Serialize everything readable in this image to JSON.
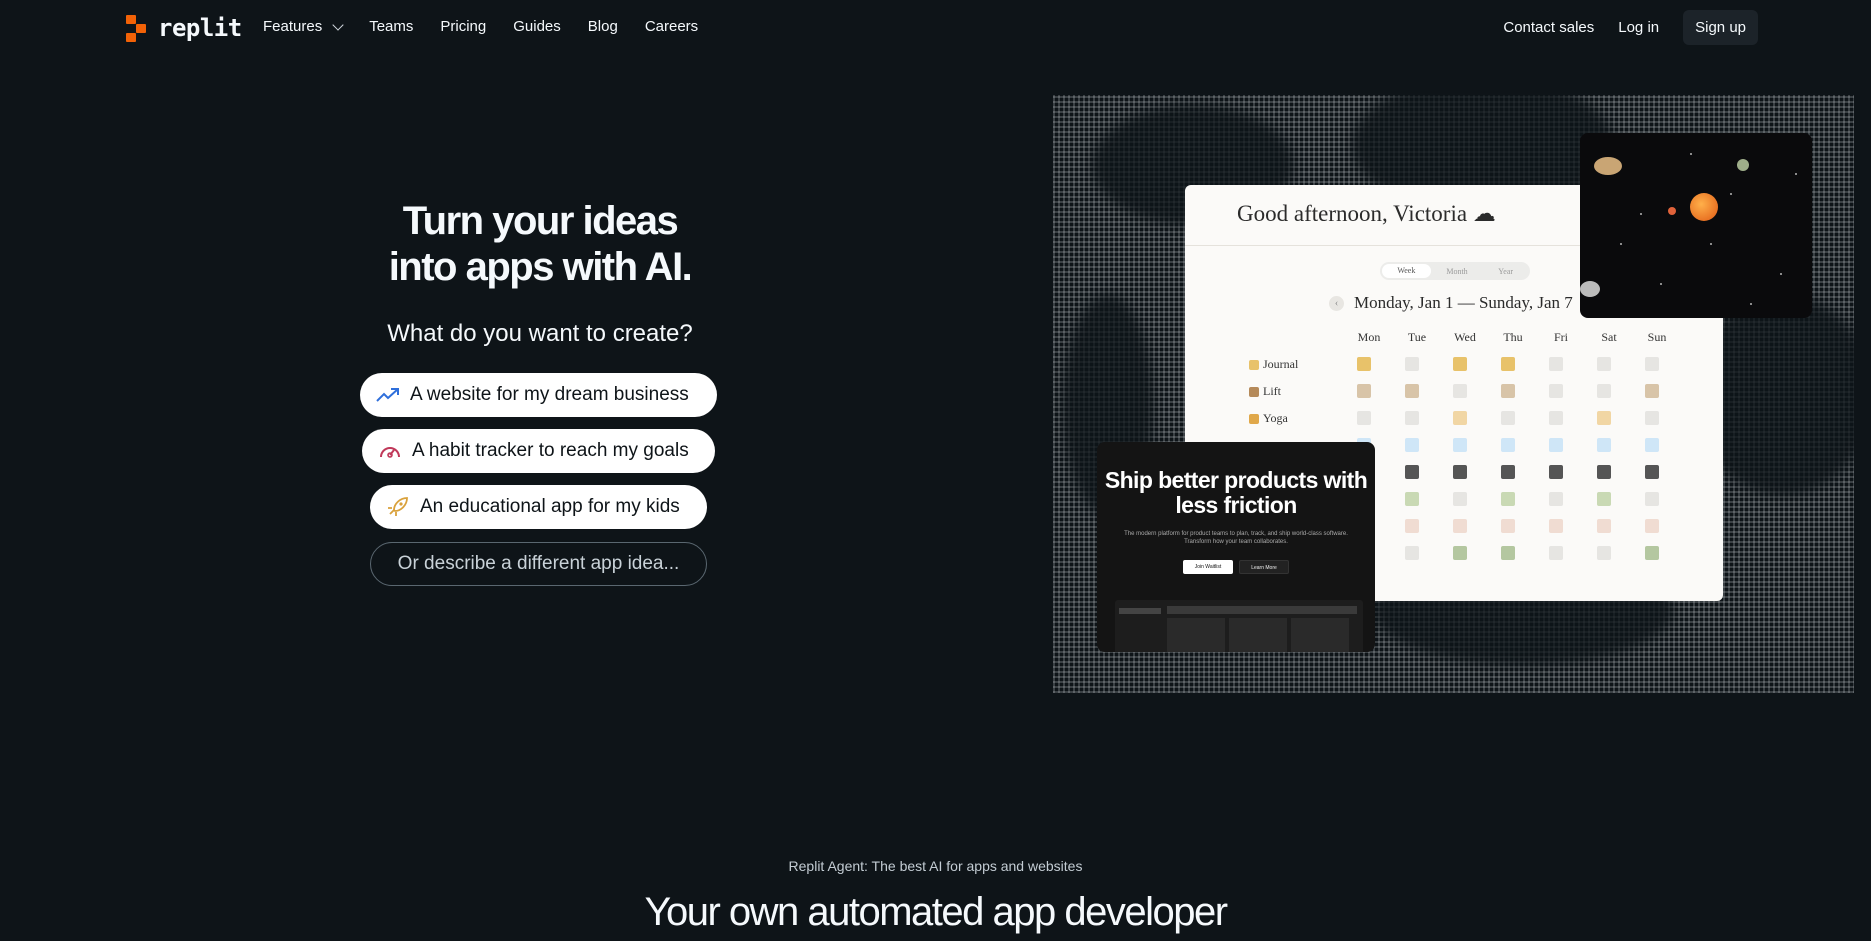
{
  "brand": {
    "name": "replit",
    "accent": "#f26207"
  },
  "nav": {
    "links": [
      {
        "label": "Features",
        "has_dropdown": true
      },
      {
        "label": "Teams"
      },
      {
        "label": "Pricing"
      },
      {
        "label": "Guides"
      },
      {
        "label": "Blog"
      },
      {
        "label": "Careers"
      }
    ],
    "contact": "Contact sales",
    "login": "Log in",
    "signup": "Sign up"
  },
  "hero": {
    "title_line1": "Turn your ideas",
    "title_line2": "into apps with AI.",
    "prompt": "What do you want to create?",
    "suggestions": [
      {
        "label": "A website for my dream business",
        "icon": "trending-up-icon",
        "color": "#2f6fdb"
      },
      {
        "label": "A habit tracker to reach my goals",
        "icon": "gauge-icon",
        "color": "#c0395a"
      },
      {
        "label": "An educational app for my kids",
        "icon": "rocket-icon",
        "color": "#d9a13b"
      }
    ],
    "describe": "Or describe a different app idea..."
  },
  "showcase": {
    "calendar": {
      "greeting": "Good afternoon, Victoria ☁",
      "tabs": [
        "Week",
        "Month",
        "Year"
      ],
      "range": "Monday, Jan 1 — Sunday, Jan 7",
      "days": [
        "Mon",
        "Tue",
        "Wed",
        "Thu",
        "Fri",
        "Sat",
        "Sun"
      ],
      "habits": [
        {
          "name": "Journal",
          "color": "#e8c26a"
        },
        {
          "name": "Lift",
          "color": "#b58a5a"
        },
        {
          "name": "Yoga",
          "color": "#e0a84a"
        }
      ]
    },
    "product": {
      "title": "Ship better products with less friction",
      "desc": "The modern platform for product teams to plan, track, and ship world-class software. Transform how your team collaborates.",
      "primary": "Join Waitlist",
      "secondary": "Learn More"
    }
  },
  "section": {
    "kicker": "Replit Agent: The best AI for apps and websites",
    "title": "Your own automated app developer"
  }
}
